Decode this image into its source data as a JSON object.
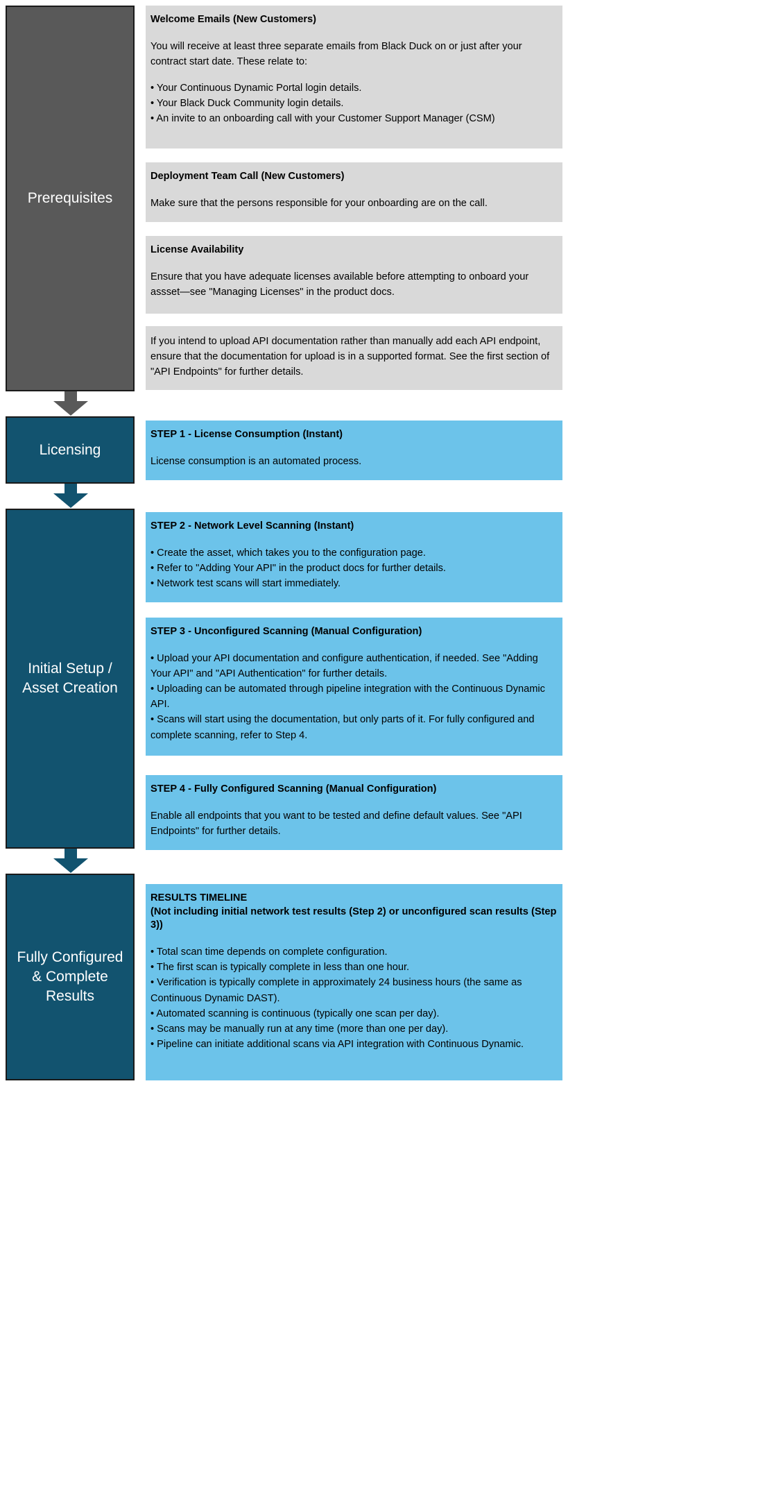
{
  "colors": {
    "prereq_stage_bg": "#595959",
    "stage_bg": "#12536f",
    "grey_card_bg": "#d9d9d9",
    "blue_card_bg": "#6cc3ea",
    "stage_border": "#1a1a1a",
    "stage_text": "#ffffff",
    "body_text": "#000000"
  },
  "stages": [
    {
      "id": "prerequisites",
      "label": "Prerequisites"
    },
    {
      "id": "licensing",
      "label": "Licensing"
    },
    {
      "id": "initial-setup",
      "label": "Initial Setup /\nAsset Creation"
    },
    {
      "id": "fully-configured",
      "label": "Fully Configured\n& Complete\nResults"
    }
  ],
  "arrows": [
    {
      "id": "arrow-prereq-to-licensing",
      "color": "#595959"
    },
    {
      "id": "arrow-licensing-to-setup",
      "color": "#12536f"
    },
    {
      "id": "arrow-setup-to-results",
      "color": "#12536f"
    }
  ],
  "cards": {
    "welcome_emails": {
      "title": "Welcome Emails (New Customers)",
      "body": "You will receive at least three separate emails from Black Duck on or just after your contract start date. These relate to:",
      "bullets": [
        "• Your Continuous Dynamic Portal login details.",
        "• Your Black Duck Community login details.",
        "• An invite to an onboarding call with your Customer Support Manager (CSM)"
      ]
    },
    "deployment_call": {
      "title": "Deployment Team Call (New Customers)",
      "body": "Make sure that the persons responsible for your onboarding are on the call."
    },
    "license_availability": {
      "title": "License Availability",
      "body": "Ensure that you have adequate licenses available before attempting to onboard your assset—see \"Managing Licenses\" in the product docs."
    },
    "api_documentation": {
      "body": "If you intend to upload API documentation rather than manually add each API endpoint, ensure that the documentation for upload is in a supported format. See the first section of \"API Endpoints\" for further details."
    },
    "step1": {
      "title": "STEP 1 - License Consumption (Instant)",
      "body": "License consumption is an automated process."
    },
    "step2": {
      "title": "STEP 2 - Network Level Scanning (Instant)",
      "bullets": [
        "• Create the asset, which takes you to the configuration page.",
        "• Refer to \"Adding Your API\" in the product docs for further details.",
        "• Network test scans will start immediately."
      ]
    },
    "step3": {
      "title": "STEP 3 - Unconfigured Scanning (Manual Configuration)",
      "bullets": [
        "• Upload your API documentation and configure authentication, if needed. See \"Adding Your API\" and \"API Authentication\" for further details.",
        "• Uploading can be automated through pipeline integration with the Continuous Dynamic API.",
        "• Scans will start using the documentation, but only parts of it. For fully configured and complete scanning, refer to Step 4."
      ]
    },
    "step4": {
      "title": "STEP 4 - Fully Configured Scanning (Manual Configuration)",
      "body": "Enable all endpoints that you want to be tested and define default values. See \"API Endpoints\" for further details."
    },
    "results_timeline": {
      "title": "RESULTS TIMELINE\n(Not including initial network test results (Step 2) or unconfigured scan results (Step 3))",
      "bullets": [
        "• Total scan time depends on complete configuration.",
        "• The first scan is typically complete in less than one hour.",
        "• Verification is typically complete in approximately 24 business hours (the same as Continuous Dynamic DAST).",
        "• Automated scanning is continuous (typically one scan per day).",
        "• Scans may be manually run at any time (more than one per day).",
        "• Pipeline can initiate additional scans via API integration with Continuous Dynamic."
      ]
    }
  }
}
